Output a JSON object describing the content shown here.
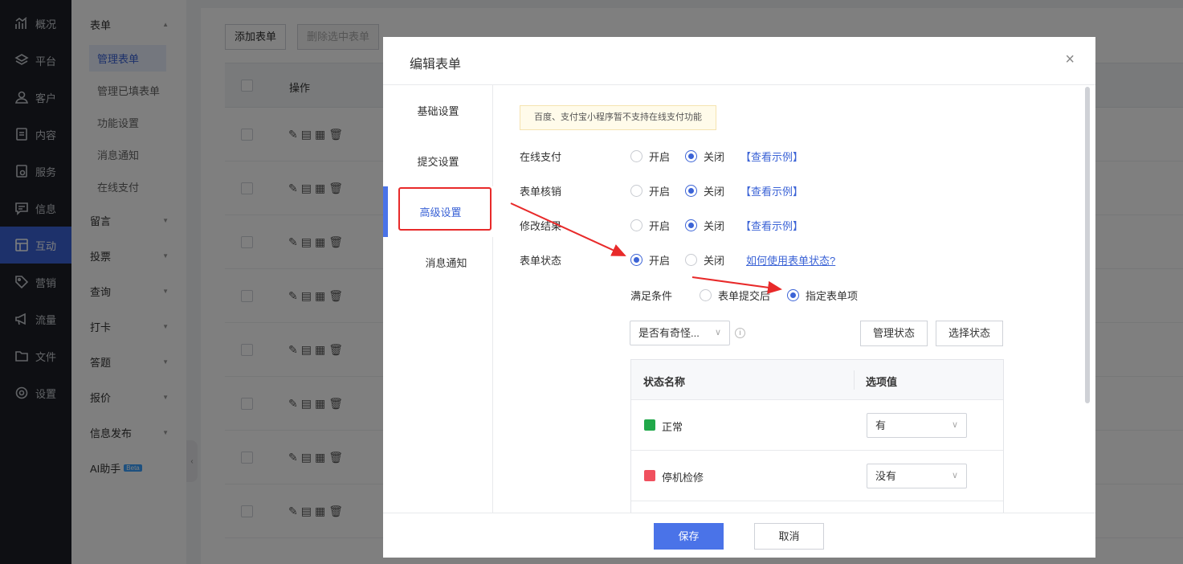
{
  "nav": {
    "items": [
      {
        "label": "概况",
        "icon": "chart-icon"
      },
      {
        "label": "平台",
        "icon": "layers-icon"
      },
      {
        "label": "客户",
        "icon": "user-icon"
      },
      {
        "label": "内容",
        "icon": "document-icon"
      },
      {
        "label": "服务",
        "icon": "service-icon"
      },
      {
        "label": "信息",
        "icon": "message-icon"
      },
      {
        "label": "互动",
        "icon": "interaction-icon"
      },
      {
        "label": "营销",
        "icon": "tag-icon"
      },
      {
        "label": "流量",
        "icon": "megaphone-icon"
      },
      {
        "label": "文件",
        "icon": "folder-icon"
      },
      {
        "label": "设置",
        "icon": "settings-icon"
      }
    ],
    "active_index": 6
  },
  "subnav": {
    "form_group": "表单",
    "form_items": [
      "管理表单",
      "管理已填表单",
      "功能设置",
      "消息通知",
      "在线支付"
    ],
    "groups": [
      "留言",
      "投票",
      "查询",
      "打卡",
      "答题",
      "报价",
      "信息发布"
    ],
    "ai": "AI助手",
    "ai_badge": "Beta"
  },
  "main": {
    "add_button": "添加表单",
    "delete_button": "删除选中表单",
    "column_ops": "操作"
  },
  "dialog": {
    "title": "编辑表单",
    "close": "×",
    "tabs": [
      "基础设置",
      "提交设置",
      "高级设置",
      "消息通知"
    ],
    "active_tab": 2,
    "notice": "百度、支付宝小程序暂不支持在线支付功能",
    "rows": [
      {
        "label": "在线支付",
        "on": "开启",
        "off": "关闭",
        "selected": "off",
        "link": "【查看示例】"
      },
      {
        "label": "表单核销",
        "on": "开启",
        "off": "关闭",
        "selected": "off",
        "link": "【查看示例】"
      },
      {
        "label": "修改结果",
        "on": "开启",
        "off": "关闭",
        "selected": "off",
        "link": "【查看示例】"
      },
      {
        "label": "表单状态",
        "on": "开启",
        "off": "关闭",
        "selected": "on",
        "link": "如何使用表单状态?"
      }
    ],
    "condition": {
      "label": "满足条件",
      "opt1": "表单提交后",
      "opt2": "指定表单项",
      "selected": "opt2"
    },
    "field_select": "是否有奇怪...",
    "manage_status": "管理状态",
    "select_status": "选择状态",
    "status_table": {
      "col_name": "状态名称",
      "col_value": "选项值",
      "rows": [
        {
          "name": "正常",
          "color": "#21a84a",
          "value": "有"
        },
        {
          "name": "停机检修",
          "color": "#f0505e",
          "value": "没有"
        }
      ]
    },
    "save": "保存",
    "cancel": "取消"
  },
  "colors": {
    "accent": "#3b63d6",
    "annotation": "#e82a2a"
  }
}
